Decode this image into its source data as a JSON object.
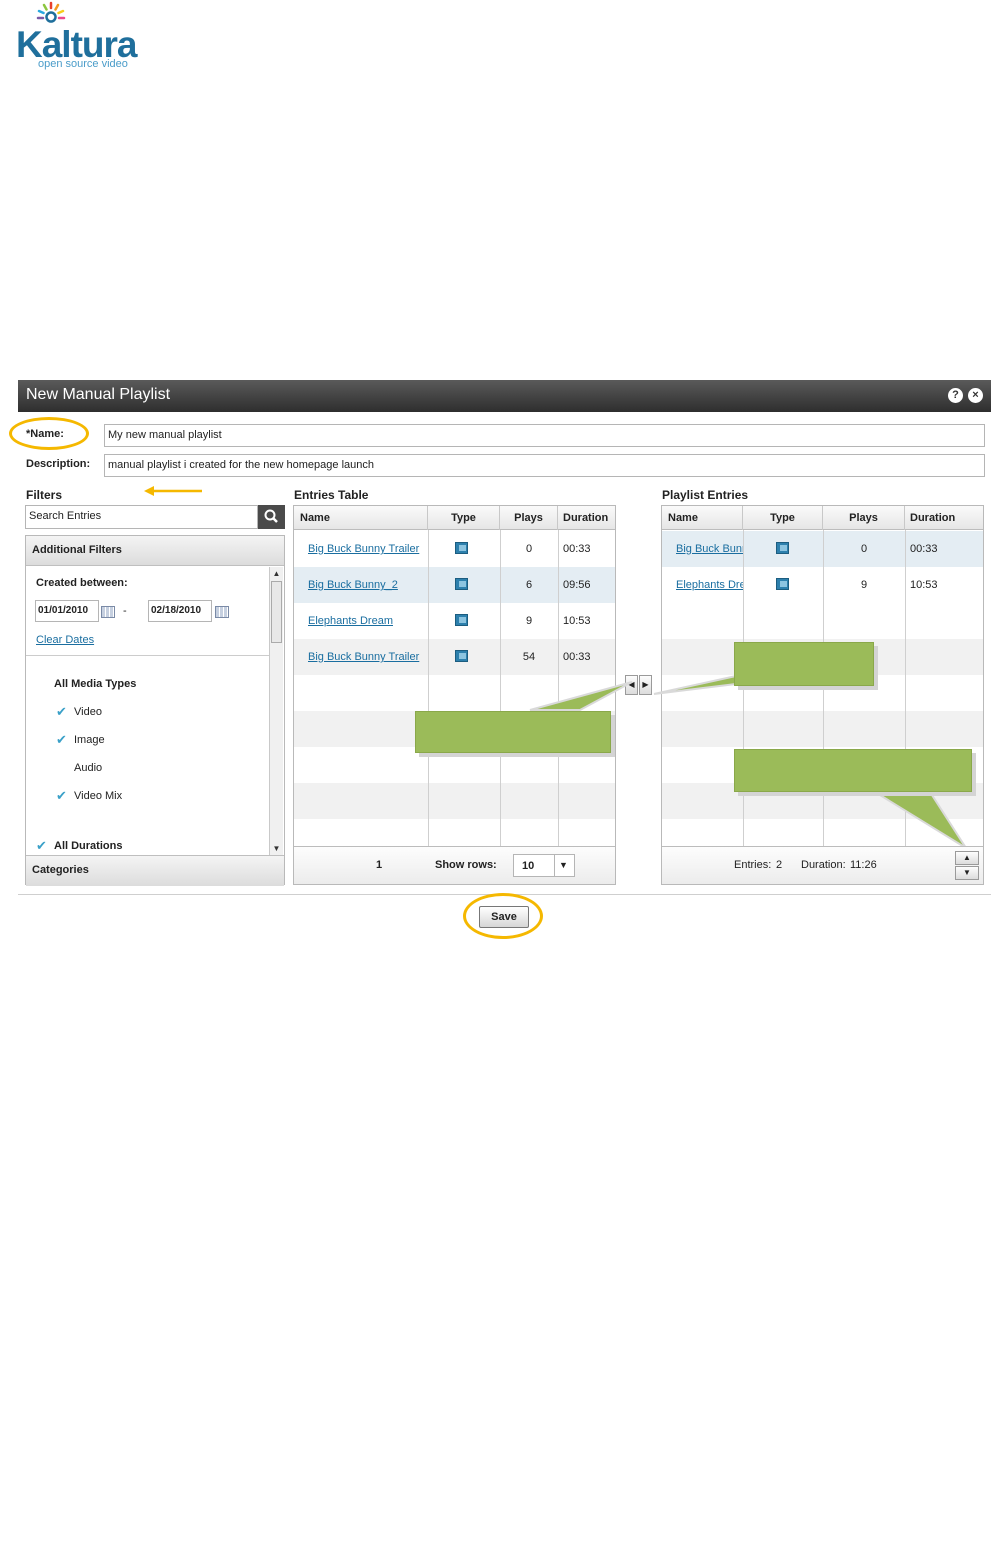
{
  "logo": {
    "name": "Kaltura",
    "tagline": "open source video"
  },
  "dialog": {
    "title": "New Manual Playlist",
    "help_icon": "?",
    "close_icon": "×"
  },
  "form": {
    "name_label": "*Name:",
    "name_value": "My new manual playlist",
    "description_label": "Description:",
    "description_value": "manual playlist i created for the new homepage launch"
  },
  "filters": {
    "title": "Filters",
    "search_placeholder": "Search  Entries",
    "additional_filters": "Additional Filters",
    "created_between_label": "Created between:",
    "date_from": "01/01/2010",
    "date_separator": "-",
    "date_to": "02/18/2010",
    "clear_dates": "Clear Dates",
    "media_types": {
      "title": "All Media Types",
      "options": [
        {
          "label": "Video",
          "checked": "✔"
        },
        {
          "label": "Image",
          "checked": "✔"
        },
        {
          "label": "Audio",
          "checked": ""
        },
        {
          "label": "Video Mix",
          "checked": "✔"
        }
      ]
    },
    "all_durations": "All Durations",
    "categories": "Categories"
  },
  "entries_table": {
    "title": "Entries Table",
    "columns": [
      "Name",
      "Type",
      "Plays",
      "Duration"
    ],
    "rows": [
      {
        "name": "Big Buck Bunny Trailer",
        "plays": "0",
        "duration": "00:33"
      },
      {
        "name": "Big Buck Bunny_2",
        "plays": "6",
        "duration": "09:56"
      },
      {
        "name": "Elephants Dream",
        "plays": "9",
        "duration": "10:53"
      },
      {
        "name": "Big Buck Bunny Trailer",
        "plays": "54",
        "duration": "00:33"
      }
    ],
    "page": "1",
    "show_rows_label": "Show rows:",
    "show_rows_value": "10"
  },
  "playlist_entries": {
    "title": "Playlist Entries",
    "columns": [
      "Name",
      "Type",
      "Plays",
      "Duration"
    ],
    "rows": [
      {
        "name": "Big Buck Bunny Trailer",
        "plays": "0",
        "duration": "00:33"
      },
      {
        "name": "Elephants Dream",
        "plays": "9",
        "duration": "10:53"
      }
    ],
    "entries_label": "Entries:",
    "entries_count": "2",
    "duration_label": "Duration:",
    "duration_total": "11:26"
  },
  "save_label": "Save",
  "colors": {
    "callout": "#9bbb59",
    "highlight_ring": "#f5b800",
    "link": "#1a6ea0"
  }
}
